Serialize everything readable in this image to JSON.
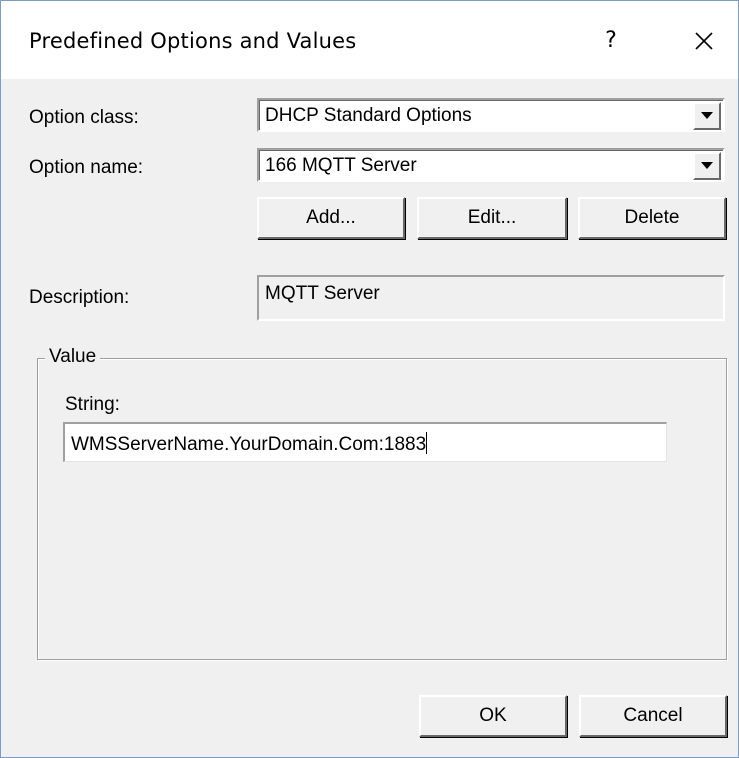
{
  "window": {
    "title": "Predefined Options and Values",
    "help_label": "?"
  },
  "option_class": {
    "label": "Option class:",
    "value": "DHCP Standard Options"
  },
  "option_name": {
    "label": "Option name:",
    "value": "166 MQTT Server"
  },
  "option_buttons": {
    "add": "Add...",
    "edit": "Edit...",
    "delete": "Delete"
  },
  "description": {
    "label": "Description:",
    "value": "MQTT Server"
  },
  "value_group": {
    "legend": "Value",
    "string_label": "String:",
    "string_value": "WMSServerName.YourDomain.Com:1883"
  },
  "footer": {
    "ok": "OK",
    "cancel": "Cancel"
  },
  "colors": {
    "dialog_bg": "#f0f0f0",
    "titlebar_bg": "#ffffff",
    "window_border": "#7a9cc6"
  },
  "icons": {
    "close": "close-icon",
    "dropdown": "chevron-down-icon"
  }
}
